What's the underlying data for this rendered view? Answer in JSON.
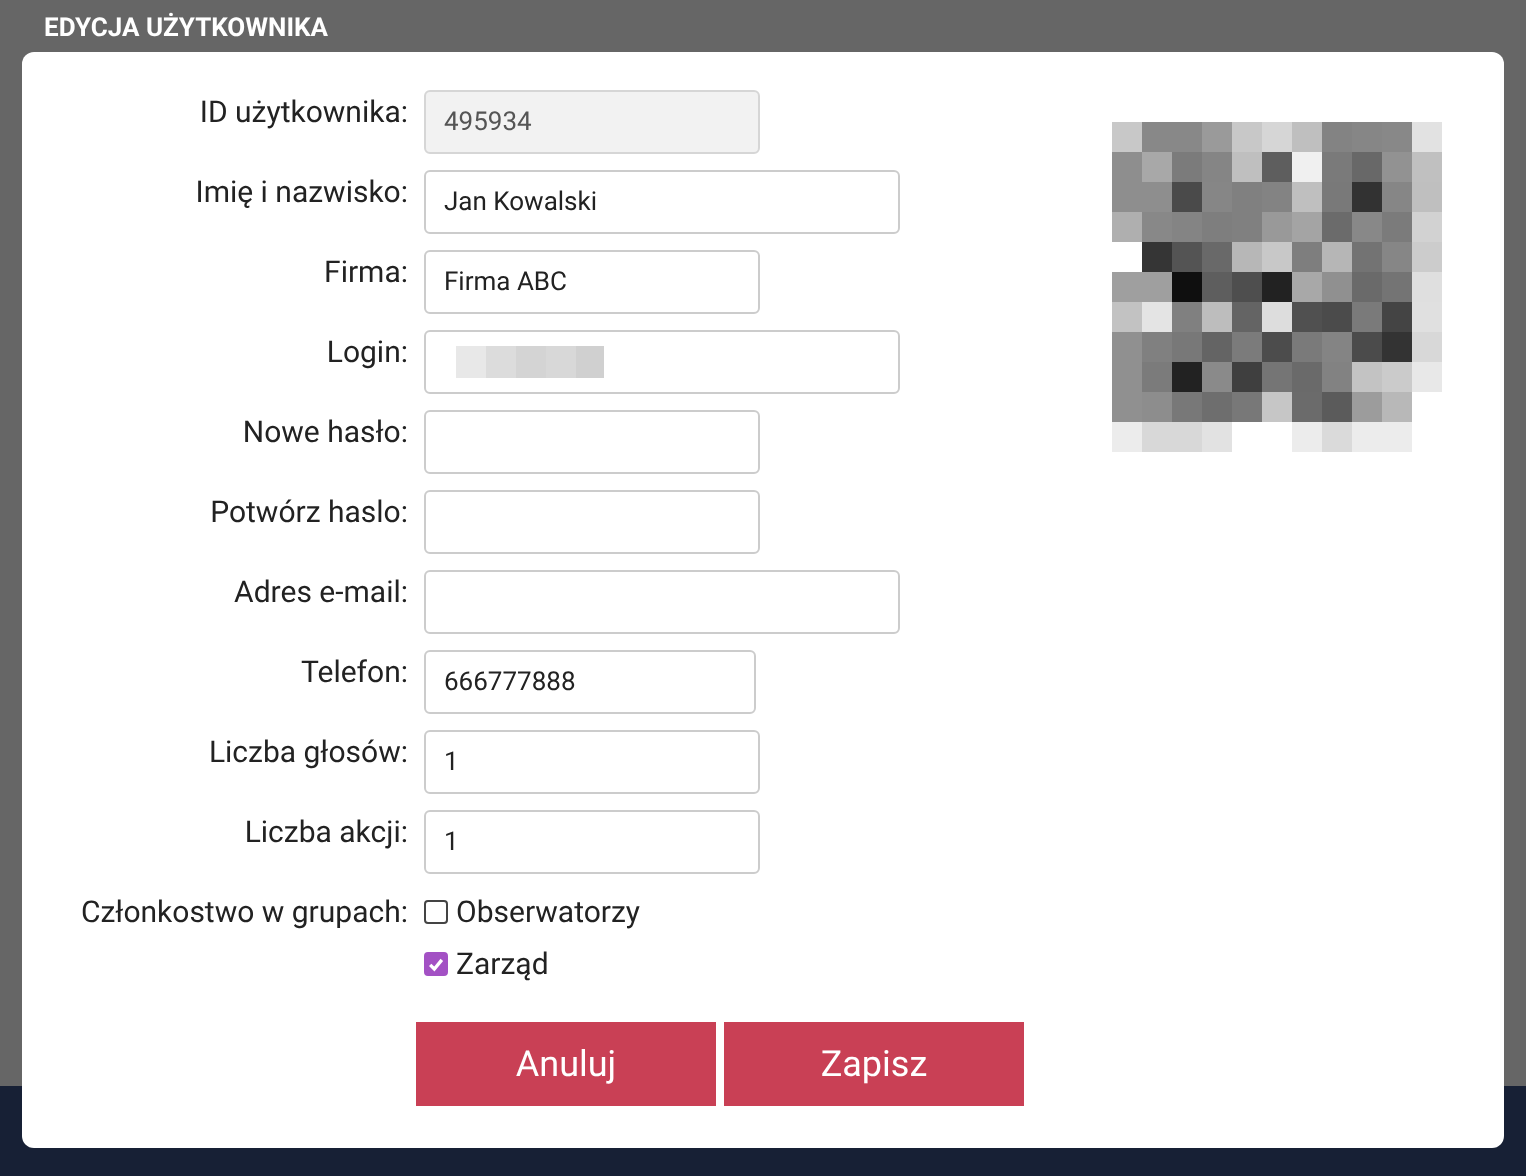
{
  "dialog": {
    "title": "EDYCJA UŻYTKOWNIKA"
  },
  "fields": [
    {
      "label": "ID użytkownika:",
      "value": "495934",
      "disabled": true,
      "redacted": false
    },
    {
      "label": "Imię i nazwisko:",
      "value": "Jan Kowalski",
      "disabled": false,
      "redacted": false
    },
    {
      "label": "Firma:",
      "value": "Firma ABC",
      "disabled": false,
      "redacted": false
    },
    {
      "label": "Login:",
      "disabled": false,
      "redacted": true
    },
    {
      "label": "Nowe hasło:",
      "disabled": false,
      "redacted": false
    },
    {
      "label": "Potwórz haslo:",
      "disabled": false,
      "redacted": false
    },
    {
      "label": "Adres e-mail:",
      "disabled": false,
      "redacted": false
    },
    {
      "label": "Telefon:",
      "value": "666777888",
      "disabled": false,
      "redacted": false
    },
    {
      "label": "Liczba głosów:",
      "value": "1",
      "disabled": false,
      "redacted": false
    },
    {
      "label": "Liczba akcji:",
      "value": "1",
      "disabled": false,
      "redacted": false
    }
  ],
  "groups": {
    "label": "Członkostwo w grupach:",
    "options": [
      {
        "label": "Obserwatorzy",
        "checked": false
      },
      {
        "label": "Zarząd",
        "checked": true
      }
    ]
  },
  "buttons": [
    "Anuluj",
    "Zapisz"
  ]
}
